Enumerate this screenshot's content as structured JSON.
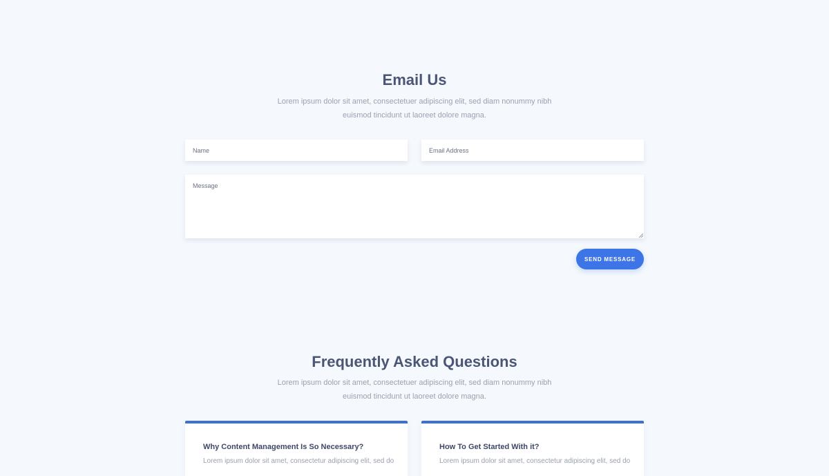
{
  "email_section": {
    "title": "Email Us",
    "description_line1": "Lorem ipsum dolor sit amet, consectetuer adipiscing elit, sed diam nonummy nibh",
    "description_line2": "euismod tincidunt ut laoreet dolore magna.",
    "name_placeholder": "Name",
    "email_placeholder": "Email Address",
    "message_placeholder": "Message",
    "send_label": "SEND MESSAGE"
  },
  "faq_section": {
    "title": "Frequently Asked Questions",
    "description_line1": "Lorem ipsum dolor sit amet, consectetuer adipiscing elit, sed diam nonummy nibh",
    "description_line2": "euismod tincidunt ut laoreet dolore magna.",
    "items": [
      {
        "question": "Why Content Management Is So Necessary?",
        "answer": "Lorem ipsum dolor sit amet, consectetur adipiscing elit, sed do"
      },
      {
        "question": "How To Get Started With it?",
        "answer": "Lorem ipsum dolor sit amet, consectetur adipiscing elit, sed do"
      }
    ]
  },
  "colors": {
    "background": "#f5f9fd",
    "accent": "#3d74e6",
    "heading": "#4b5575",
    "muted": "#9aa0ae"
  }
}
